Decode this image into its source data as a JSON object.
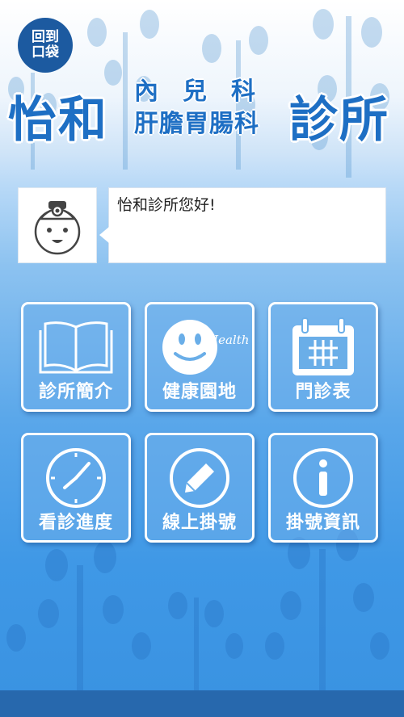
{
  "back_button": {
    "line1": "回到",
    "line2": "口袋"
  },
  "header": {
    "name": "怡和",
    "dept_line1": "內兒科",
    "dept_line2": "肝膽胃腸科",
    "suffix": "診所"
  },
  "greeting": {
    "text": "怡和診所您好!"
  },
  "icons": {
    "avatar": "doctor-mascot-icon",
    "about": "open-book-icon",
    "health": "smiley-face-icon",
    "schedule": "calendar-icon",
    "progress": "clock-icon",
    "register": "pencil-icon",
    "info": "info-icon"
  },
  "health_icon_text": "Health",
  "menu": [
    {
      "label": "診所簡介"
    },
    {
      "label": "健康園地"
    },
    {
      "label": "門診表"
    },
    {
      "label": "看診進度"
    },
    {
      "label": "線上掛號"
    },
    {
      "label": "掛號資訊"
    }
  ],
  "colors": {
    "brand": "#1e6fc4",
    "dark_blue": "#1c5aa0",
    "footer": "#2768ad"
  }
}
